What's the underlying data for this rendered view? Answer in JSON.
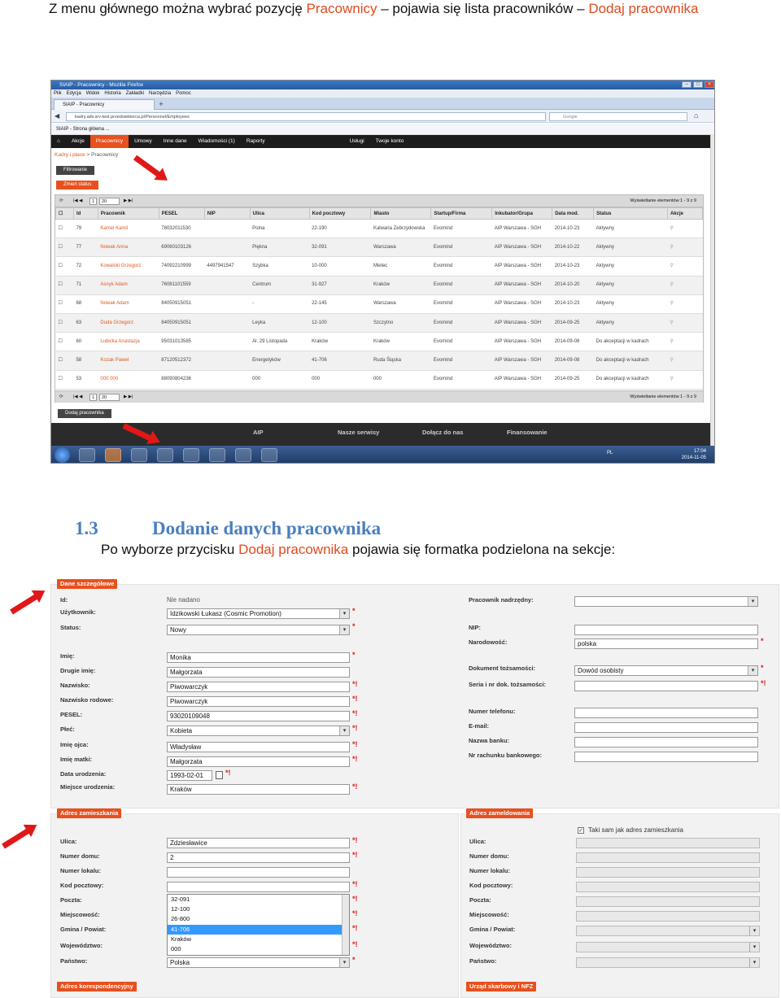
{
  "intro": {
    "part1": "Z menu głównego można wybrać pozycję ",
    "hl1": "Pracownicy",
    "part2": " – pojawia się lista pracowników – ",
    "hl2": "Dodaj pracownika"
  },
  "browser": {
    "window_title": "SIAIP - Pracownicy - Mozilla Firefox",
    "menu": [
      "Plik",
      "Edycja",
      "Widok",
      "Historia",
      "Zakładki",
      "Narzędzia",
      "Pomoc"
    ],
    "tab_title": "SIAIP - Pracownicy",
    "url": "kadry.adv.srv-test.przedsiebiorca.pl/Personnel/Employees",
    "search_placeholder": "Google",
    "bookmark": "SIAIP - Strona główna ...",
    "nav": [
      "Akcje",
      "Pracownicy",
      "Umowy",
      "Inne dane",
      "Wiadomości (1)",
      "Raporty",
      "Usługi",
      "Twoje konto"
    ],
    "breadcrumb_link": "Kadry i płace",
    "breadcrumb_current": "Pracownicy",
    "btn_filter": "Filtrowanie",
    "btn_status": "Zmień status",
    "pager_page": "1",
    "pager_size": "20",
    "pager_info": "Wyświetlanie elementów 1 - 9 z 9",
    "columns": [
      "Id",
      "Pracownik",
      "PESEL",
      "NIP",
      "Ulica",
      "Kod pocztowy",
      "Miasto",
      "Startup/Firma",
      "Inkubator/Grupa",
      "Data mod.",
      "Status",
      "Akcje"
    ],
    "rows": [
      [
        "79",
        "Kamel Kamil",
        "78032011530",
        "",
        "Polna",
        "22-190",
        "Kalwaria Zebrzydowska",
        "Evomind",
        "AIP Warszawa - SGH",
        "2014-10-23",
        "Aktywny"
      ],
      [
        "77",
        "Nowak Anna",
        "69060103126",
        "",
        "Piękna",
        "32-091",
        "Warszawa",
        "Evomind",
        "AIP Warszawa - SGH",
        "2014-10-22",
        "Aktywny"
      ],
      [
        "72",
        "Kowalski Grzegorz",
        "74092210999",
        "4497941547",
        "Szybka",
        "10-000",
        "Mielec",
        "Evomind",
        "AIP Warszawa - SGH",
        "2014-10-23",
        "Aktywny"
      ],
      [
        "71",
        "Asnyk Adam",
        "76081101559",
        "",
        "Centrum",
        "31-927",
        "Kraków",
        "Evomind",
        "AIP Warszawa - SGH",
        "2014-10-20",
        "Aktywny"
      ],
      [
        "68",
        "Nowak Adam",
        "84050915051",
        "",
        "-",
        "22-145",
        "Warszawa",
        "Evomind",
        "AIP Warszawa - SGH",
        "2014-10-23",
        "Aktywny"
      ],
      [
        "63",
        "Duda Grzegorz",
        "84050915051",
        "",
        "Leyka",
        "12-100",
        "Szczytno",
        "Evomind",
        "AIP Warszawa - SGH",
        "2014-09-25",
        "Aktywny"
      ],
      [
        "60",
        "Lubicka Anastazja",
        "95031013585",
        "",
        "Al. 29 Listopada",
        "Kraków",
        "Kraków",
        "Evomind",
        "AIP Warszawa - SGH",
        "2014-09-08",
        "Do akceptacji w kadrach"
      ],
      [
        "58",
        "Kozak Paweł",
        "87120512372",
        "",
        "Energetyków",
        "41-706",
        "Ruda Śląska",
        "Evomind",
        "AIP Warszawa - SGH",
        "2014-09-08",
        "Do akceptacji w kadrach"
      ],
      [
        "53",
        "000 000",
        "88090804236",
        "",
        "000",
        "000",
        "000",
        "Evomind",
        "AIP Warszawa - SGH",
        "2014-09-25",
        "Do akceptacji w kadrach"
      ]
    ],
    "btn_add": "Dodaj pracownika",
    "footer": [
      "AIP",
      "Nasze serwisy",
      "Dołącz do nas",
      "Finansowanie"
    ],
    "tray_lang": "PL",
    "clock_time": "17:04",
    "clock_date": "2014-11-05"
  },
  "section": {
    "number": "1.3",
    "title": "Dodanie danych pracownika",
    "para1": "Po wyborze przycisku ",
    "para_hl": "Dodaj pracownika",
    "para2": " pojawia się formatka podzielona na sekcje:"
  },
  "form": {
    "details_title": "Dane szczegółowe",
    "id_label": "Id:",
    "id_value": "Nie nadano",
    "user_label": "Użytkownik:",
    "user_value": "Idzikowski Łukasz (Cosmic Promotion)",
    "status_label": "Status:",
    "status_value": "Nowy",
    "first_name_label": "Imię:",
    "first_name_value": "Monika",
    "second_name_label": "Drugie imię:",
    "second_name_value": "Małgorzata",
    "surname_label": "Nazwisko:",
    "surname_value": "Piwowarczyk",
    "family_name_label": "Nazwisko rodowe:",
    "family_name_value": "Piwowarczyk",
    "pesel_label": "PESEL:",
    "pesel_value": "93020109048",
    "sex_label": "Płeć:",
    "sex_value": "Kobieta",
    "father_label": "Imię ojca:",
    "father_value": "Władysław",
    "mother_label": "Imię matki:",
    "mother_value": "Małgorzata",
    "birth_date_label": "Data urodzenia:",
    "birth_date_value": "1993-02-01",
    "birth_place_label": "Miejsce urodzenia:",
    "birth_place_value": "Kraków",
    "supervisor_label": "Pracownik nadrzędny:",
    "nip_label": "NIP:",
    "nationality_label": "Narodowość:",
    "nationality_value": "polska",
    "id_doc_label": "Dokument tożsamości:",
    "id_doc_value": "Dowód osobisty",
    "id_doc_number_label": "Seria i nr dok. tożsamości:",
    "phone_label": "Numer telefonu:",
    "email_label": "E-mail:",
    "bank_label": "Nazwa banku:",
    "account_label": "Nr rachunku bankowego:",
    "address_res_title": "Adres zamieszkania",
    "address_reg_title": "Adres zameldowania",
    "street_label": "Ulica:",
    "street_value": "Zdziesławice",
    "house_label": "Numer domu:",
    "house_value": "2",
    "flat_label": "Numer lokalu:",
    "postcode_label": "Kod pocztowy:",
    "post_label": "Poczta:",
    "city_label": "Miejscowość:",
    "commune_label": "Gmina / Powiat:",
    "voivodeship_label": "Województwo:",
    "country_label": "Państwo:",
    "country_value": "Polska",
    "postcode_suggestions": [
      "32-091",
      "12-100",
      "26-800",
      "41-706",
      "Kraków",
      "000"
    ],
    "same_as_label": "Taki sam jak adres zamieszkania",
    "corr_title": "Adres korespondencyjny",
    "tax_title": "Urząd skarbowy i NFZ",
    "req_mark": "*",
    "err_mark": "*!"
  },
  "colors": {
    "accent": "#e8501e",
    "heading": "#4a7fbf",
    "arrow": "#e01818"
  }
}
